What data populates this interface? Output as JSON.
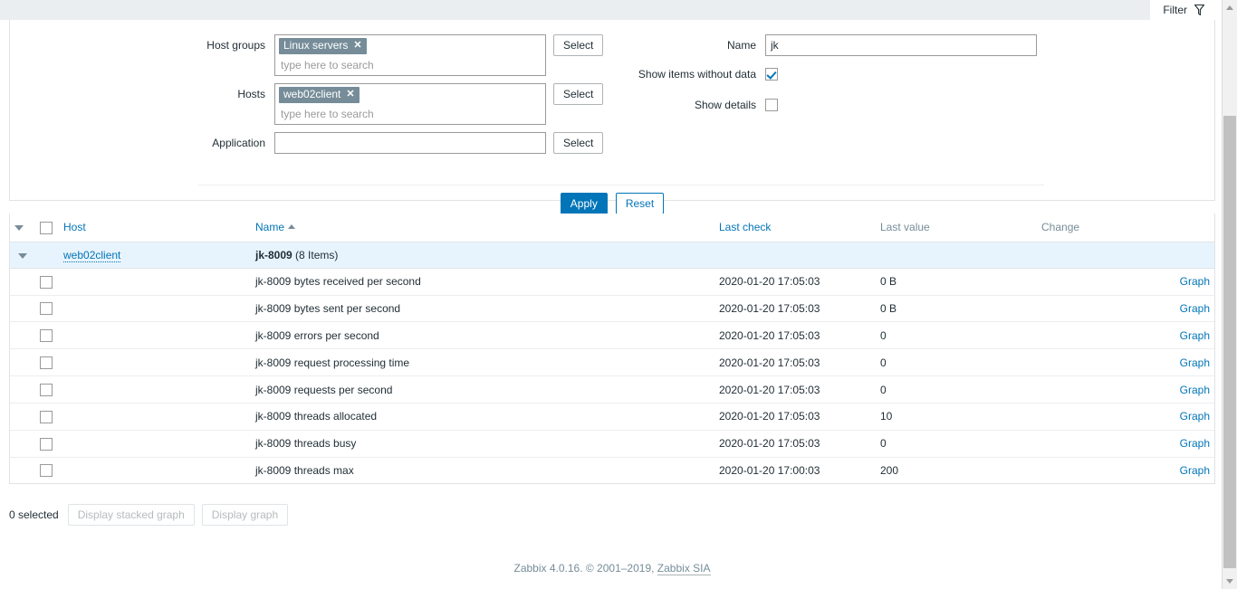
{
  "filter": {
    "tab_label": "Filter",
    "tab_icon": "funnel-icon",
    "host_groups": {
      "label": "Host groups",
      "chips": [
        "Linux servers"
      ],
      "placeholder": "type here to search",
      "select_label": "Select"
    },
    "hosts": {
      "label": "Hosts",
      "chips": [
        "web02client"
      ],
      "placeholder": "type here to search",
      "select_label": "Select"
    },
    "application": {
      "label": "Application",
      "value": "",
      "placeholder": "",
      "select_label": "Select"
    },
    "name": {
      "label": "Name",
      "value": "jk",
      "placeholder": ""
    },
    "show_items_without_data": {
      "label": "Show items without data",
      "checked": true
    },
    "show_details": {
      "label": "Show details",
      "checked": false
    },
    "apply_label": "Apply",
    "reset_label": "Reset"
  },
  "table": {
    "headers": {
      "host": "Host",
      "name": "Name",
      "sort_indicator": "ascending",
      "last_check": "Last check",
      "last_value": "Last value",
      "change": "Change"
    },
    "group": {
      "host": "web02client",
      "name": "jk-8009",
      "count_label": "(8 Items)"
    },
    "rows": [
      {
        "name": "jk-8009 bytes received per second",
        "last_check": "2020-01-20 17:05:03",
        "last_value": "0 B",
        "change": "",
        "action": "Graph"
      },
      {
        "name": "jk-8009 bytes sent per second",
        "last_check": "2020-01-20 17:05:03",
        "last_value": "0 B",
        "change": "",
        "action": "Graph"
      },
      {
        "name": "jk-8009 errors per second",
        "last_check": "2020-01-20 17:05:03",
        "last_value": "0",
        "change": "",
        "action": "Graph"
      },
      {
        "name": "jk-8009 request processing time",
        "last_check": "2020-01-20 17:05:03",
        "last_value": "0",
        "change": "",
        "action": "Graph"
      },
      {
        "name": "jk-8009 requests per second",
        "last_check": "2020-01-20 17:05:03",
        "last_value": "0",
        "change": "",
        "action": "Graph"
      },
      {
        "name": "jk-8009 threads allocated",
        "last_check": "2020-01-20 17:05:03",
        "last_value": "10",
        "change": "",
        "action": "Graph"
      },
      {
        "name": "jk-8009 threads busy",
        "last_check": "2020-01-20 17:05:03",
        "last_value": "0",
        "change": "",
        "action": "Graph"
      },
      {
        "name": "jk-8009 threads max",
        "last_check": "2020-01-20 17:00:03",
        "last_value": "200",
        "change": "",
        "action": "Graph"
      }
    ]
  },
  "footer": {
    "selected_text": "0 selected",
    "display_stacked_graph_label": "Display stacked graph",
    "display_graph_label": "Display graph",
    "copyright_prefix": "Zabbix 4.0.16. © 2001–2019, ",
    "copyright_link": "Zabbix SIA"
  },
  "colors": {
    "accent": "#0275b8",
    "chip": "#768d99",
    "group_row": "#e8f4fd",
    "muted": "#768d99"
  }
}
